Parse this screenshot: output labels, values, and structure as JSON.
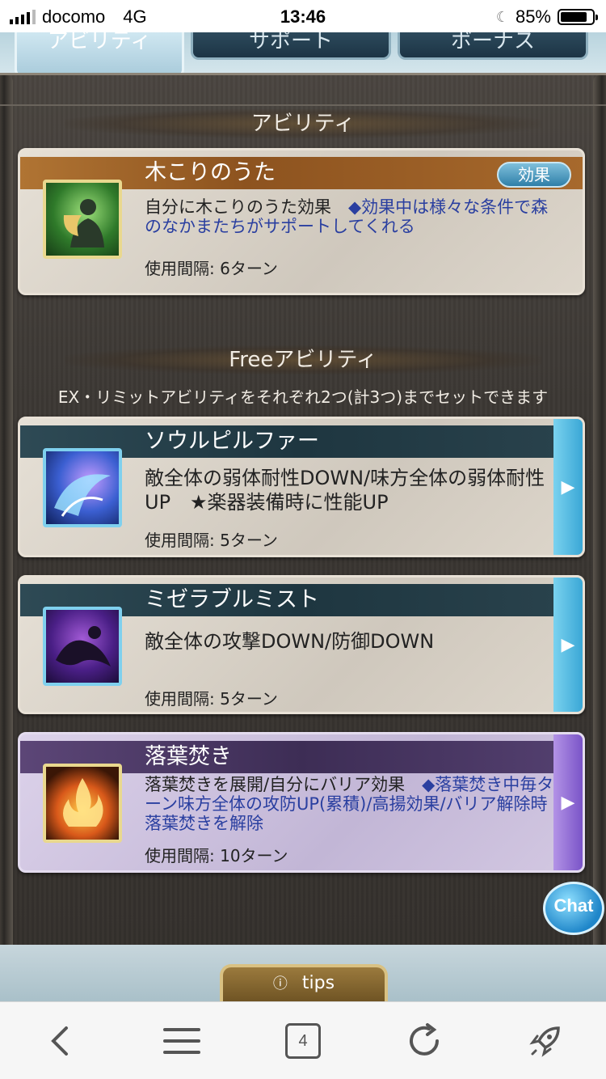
{
  "status_bar": {
    "carrier": "docomo",
    "network": "4G",
    "time": "13:46",
    "battery_percent": "85%",
    "battery_level": 0.85
  },
  "tabs": [
    {
      "label": "アビリティ",
      "active": true
    },
    {
      "label": "サポート",
      "active": false
    },
    {
      "label": "ボーナス",
      "active": false
    }
  ],
  "ability_section": {
    "title": "アビリティ",
    "card": {
      "name": "木こりのうた",
      "effect_button": "効果",
      "desc_plain": "自分に木こりのうた効果　",
      "desc_highlight": "◆効果中は様々な条件で森のなかまたちがサポートしてくれる",
      "interval": "使用間隔: 6ターン"
    }
  },
  "free_section": {
    "title": "Freeアビリティ",
    "subtitle": "EX・リミットアビリティをそれぞれ2つ(計3つ)までセットできます",
    "cards": [
      {
        "name": "ソウルピルファー",
        "desc_plain": "敵全体の弱体耐性DOWN/味方全体の弱体耐性UP　★楽器装備時に性能UP",
        "desc_highlight": "",
        "interval": "使用間隔: 5ターン"
      },
      {
        "name": "ミゼラブルミスト",
        "desc_plain": "敵全体の攻撃DOWN/防御DOWN",
        "desc_highlight": "",
        "interval": "使用間隔: 5ターン"
      },
      {
        "name": "落葉焚き",
        "desc_plain": "落葉焚きを展開/自分にバリア効果　",
        "desc_highlight": "◆落葉焚き中毎ターン味方全体の攻防UP(累積)/高揚効果/バリア解除時落葉焚きを解除",
        "interval": "使用間隔: 10ターン"
      }
    ]
  },
  "chat_button": "Chat",
  "tips_button": "tips",
  "browser": {
    "tab_count": "4"
  },
  "icons": [
    "back-icon",
    "menu-icon",
    "tabs-icon",
    "reload-icon",
    "rocket-icon",
    "arrow-right-icon"
  ]
}
